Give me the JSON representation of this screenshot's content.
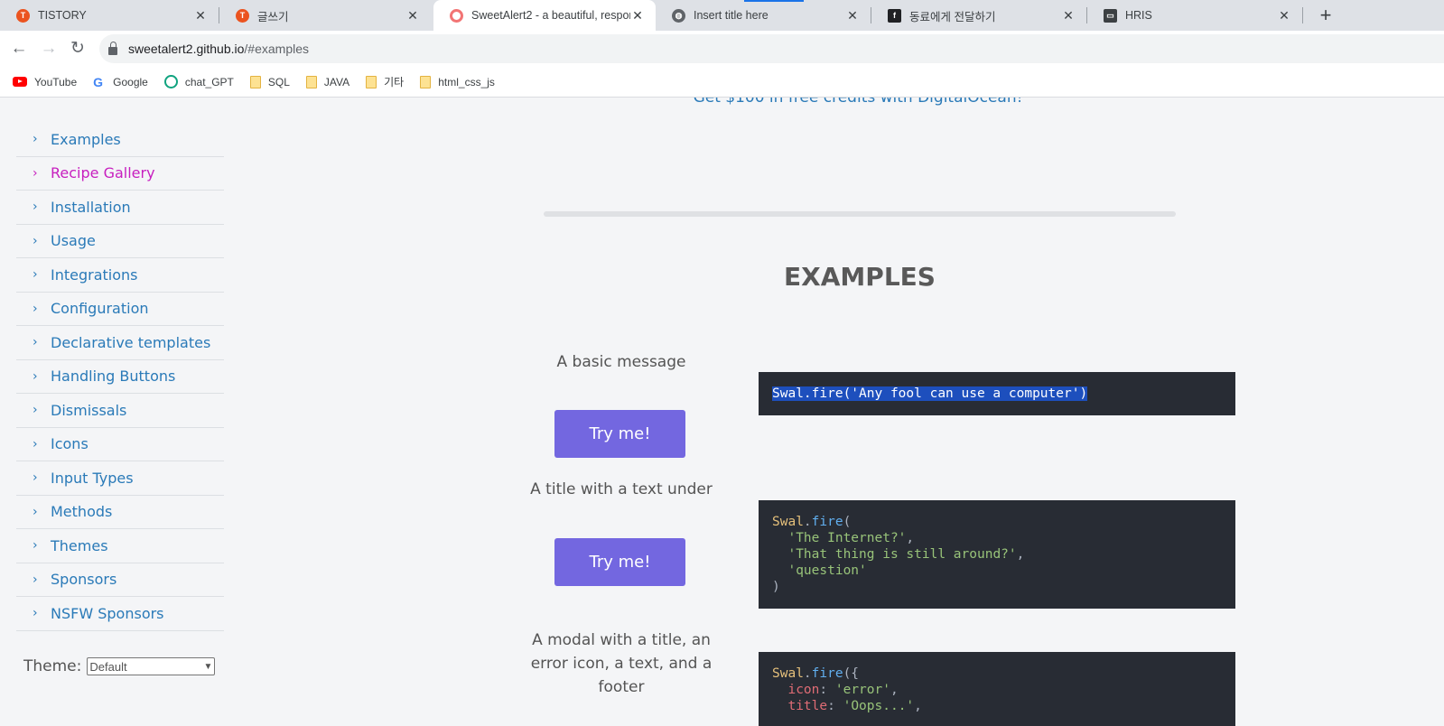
{
  "browser": {
    "tabs": [
      {
        "title": "TISTORY",
        "icon": "tistory-icon",
        "color": "#eb531f",
        "active": false
      },
      {
        "title": "글쓰기",
        "icon": "tistory-icon",
        "color": "#eb531f",
        "active": false
      },
      {
        "title": "SweetAlert2 - a beautiful, respon",
        "icon": "sweetalert-icon",
        "color": "#f27474",
        "active": true
      },
      {
        "title": "Insert title here",
        "icon": "globe-icon",
        "color": "#5f6368",
        "active": false
      },
      {
        "title": "동료에게 전달하기",
        "icon": "flex-icon",
        "color": "#202124",
        "active": false
      },
      {
        "title": "HRIS",
        "icon": "monitor-icon",
        "color": "#3c4043",
        "active": false
      }
    ],
    "new_tab_label": "+",
    "url_host": "sweetalert2.github.io",
    "url_path": "/#examples",
    "bookmarks": [
      {
        "label": "YouTube",
        "icon": "youtube-icon"
      },
      {
        "label": "Google",
        "icon": "google-icon"
      },
      {
        "label": "chat_GPT",
        "icon": "chatgpt-icon"
      },
      {
        "label": "SQL",
        "icon": "folder-icon"
      },
      {
        "label": "JAVA",
        "icon": "folder-icon"
      },
      {
        "label": "기타",
        "icon": "folder-icon"
      },
      {
        "label": "html_css_js",
        "icon": "folder-icon"
      }
    ]
  },
  "sidebar": {
    "items": [
      {
        "label": "Examples"
      },
      {
        "label": "Recipe Gallery"
      },
      {
        "label": "Installation"
      },
      {
        "label": "Usage"
      },
      {
        "label": "Integrations"
      },
      {
        "label": "Configuration"
      },
      {
        "label": "Declarative templates"
      },
      {
        "label": "Handling Buttons"
      },
      {
        "label": "Dismissals"
      },
      {
        "label": "Icons"
      },
      {
        "label": "Input Types"
      },
      {
        "label": "Methods"
      },
      {
        "label": "Themes"
      },
      {
        "label": "Sponsors"
      },
      {
        "label": "NSFW Sponsors"
      }
    ],
    "chevron": "›",
    "theme_label": "Theme:",
    "theme_value": "Default"
  },
  "main": {
    "promo": "Get $100 in free credits with DigitalOcean!",
    "section_title": "EXAMPLES",
    "examples": [
      {
        "label": "A basic message",
        "button": "Try me!"
      },
      {
        "label": "A title with a text under",
        "button": "Try me!"
      },
      {
        "label": "A modal with a title, an error icon, a text, and a footer"
      }
    ],
    "code": {
      "ex1": {
        "line": "Swal.fire('Any fool can use a computer')"
      },
      "ex2": {
        "obj": "Swal",
        "dot": ".",
        "fn": "fire",
        "open": "(",
        "s1": "'The Internet?'",
        "s2": "'That thing is still around?'",
        "s3": "'question'",
        "comma": ",",
        "close": ")"
      },
      "ex3": {
        "obj": "Swal",
        "dot": ".",
        "fn": "fire",
        "open": "({",
        "k1": "icon",
        "v1": "'error'",
        "k2": "title",
        "v2": "'Oops...'",
        "colon": ": ",
        "comma": ","
      }
    }
  }
}
